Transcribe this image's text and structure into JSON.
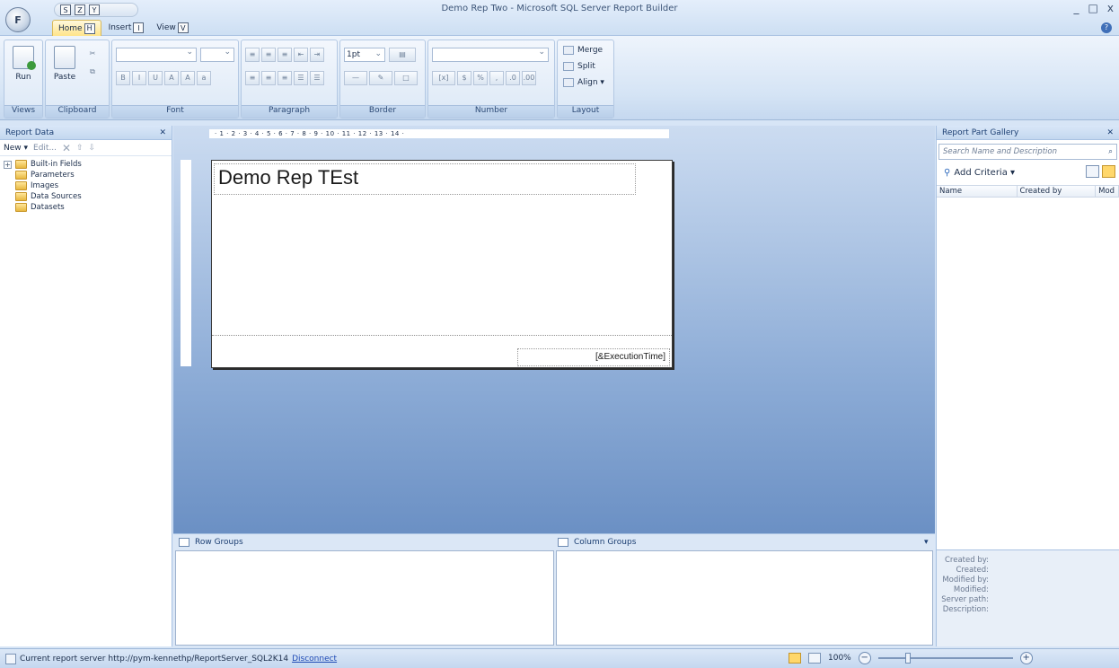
{
  "window": {
    "title": "Demo Rep Two - Microsoft SQL Server Report Builder",
    "orb_letter": "F",
    "qat_keytips": [
      "S",
      "Z",
      "Y"
    ],
    "controls": [
      "_",
      "□",
      "x"
    ]
  },
  "tabs": [
    {
      "label": "Home",
      "key": "H"
    },
    {
      "label": "Insert",
      "key": "I"
    },
    {
      "label": "View",
      "key": "V"
    }
  ],
  "ribbon": {
    "groups": {
      "views": "Views",
      "clipboard": "Clipboard",
      "font": "Font",
      "paragraph": "Paragraph",
      "border": "Border",
      "number": "Number",
      "layout": "Layout"
    },
    "run_label": "Run",
    "paste_label": "Paste",
    "border_width": "1pt",
    "merge_label": "Merge",
    "split_label": "Split",
    "align_label": "Align ▾"
  },
  "report_data": {
    "title": "Report Data",
    "toolbar": {
      "new": "New ▾",
      "edit": "Edit..."
    },
    "items": [
      "Built-in Fields",
      "Parameters",
      "Images",
      "Data Sources",
      "Datasets"
    ]
  },
  "design": {
    "ruler_text": "·  1  ·  2  ·  3  ·  4  ·  5  ·  6  ·  7  ·  8  ·  9  ·  10  ·  11  ·  12  ·  13  ·  14  ·",
    "report_title": "Demo Rep TEst",
    "footer_expression": "[&ExecutionTime]"
  },
  "groups": {
    "row_label": "Row Groups",
    "column_label": "Column Groups"
  },
  "gallery": {
    "title": "Report Part Gallery",
    "search_placeholder": "Search Name and Description",
    "add_criteria": "Add Criteria ▾",
    "columns": [
      "Name",
      "Created by",
      "Mod"
    ],
    "details_labels": [
      "Created by:",
      "Created:",
      "Modified by:",
      "Modified:",
      "Server path:",
      "Description:"
    ]
  },
  "status": {
    "server_text": "Current report server http://pym-kennethp/ReportServer_SQL2K14",
    "disconnect": "Disconnect",
    "zoom": "100%"
  },
  "colors": {
    "accent": "#ffd76b",
    "design_bg_top": "#ccdcf1",
    "design_bg_bottom": "#6b90c4"
  }
}
